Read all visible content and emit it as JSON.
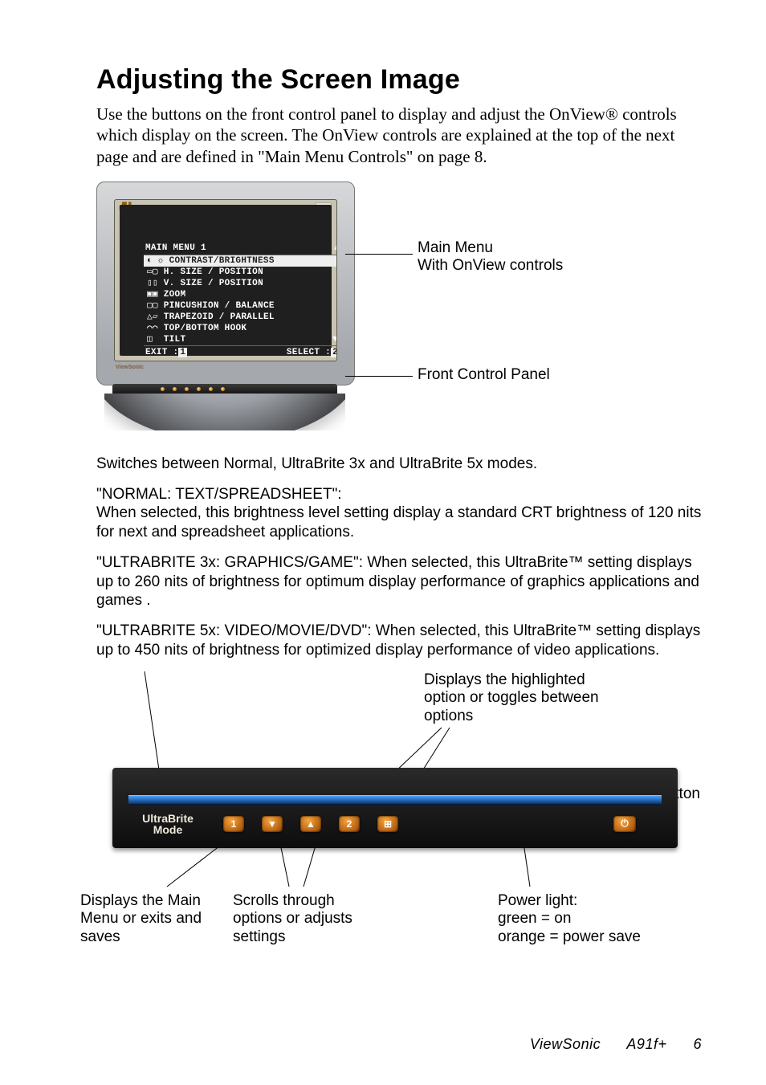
{
  "title": "Adjusting the Screen Image",
  "intro": "Use the buttons on the front control panel to display and adjust the OnView® controls which display on the screen. The OnView controls are explained at the top of the next page and are defined in \"Main Menu Controls\" on page  8.",
  "monitor": {
    "brand_small": "ViewSonic",
    "osd": {
      "title_left": "MAIN MENU 1",
      "title_arrow_up": "▲",
      "items": [
        "CONTRAST/BRIGHTNESS",
        "H. SIZE / POSITION",
        "V. SIZE / POSITION",
        "ZOOM",
        "PINCUSHION / BALANCE",
        "TRAPEZOID / PARALLEL",
        "TOP/BOTTOM HOOK",
        "TILT"
      ],
      "arrow_down": "▼",
      "footer_left_a": "EXIT :",
      "footer_left_b": "1",
      "footer_right_a": "SELECT :",
      "footer_right_b": "2"
    },
    "callout_top_1": "Main Menu",
    "callout_top_2": "With OnView controls",
    "callout_bottom": "Front Control Panel"
  },
  "paragraphs": {
    "switches": "Switches between Normal, UltraBrite 3x and UltraBrite 5x modes.",
    "normal_head": "\"NORMAL: TEXT/SPREADSHEET\":",
    "normal_body": "When selected, this brightness level setting display a standard CRT brightness of 120 nits for next and spreadsheet applications.",
    "u3x": "\"ULTRABRITE 3x: GRAPHICS/GAME\": When selected, this UltraBrite™ setting displays up to 260 nits of brightness for optimum display performance of graphics applications and games .",
    "u5x": "\"ULTRABRITE 5x: VIDEO/MOVIE/DVD\": When selected, this UltraBrite™ setting displays up to 450 nits of brightness for optimized display performance of video applications."
  },
  "panel": {
    "ultrabrite_l1": "UltraBrite",
    "ultrabrite_l2": "Mode",
    "btn1": "1",
    "down": "▼",
    "up": "▲",
    "btn2": "2",
    "toggle": "⊞",
    "power": "⏻"
  },
  "captions": {
    "highlighted": "Displays the highlighted option or toggles between options",
    "power_btn": "Power button",
    "main_menu": "Displays the Main Menu or exits and saves",
    "scrolls": "Scrolls through options or adjusts settings",
    "power_light_1": "Power light:",
    "power_light_2": "green = on",
    "power_light_3": "orange = power save"
  },
  "footer": {
    "brand": "ViewSonic",
    "model": "A91f+",
    "page": "6"
  }
}
